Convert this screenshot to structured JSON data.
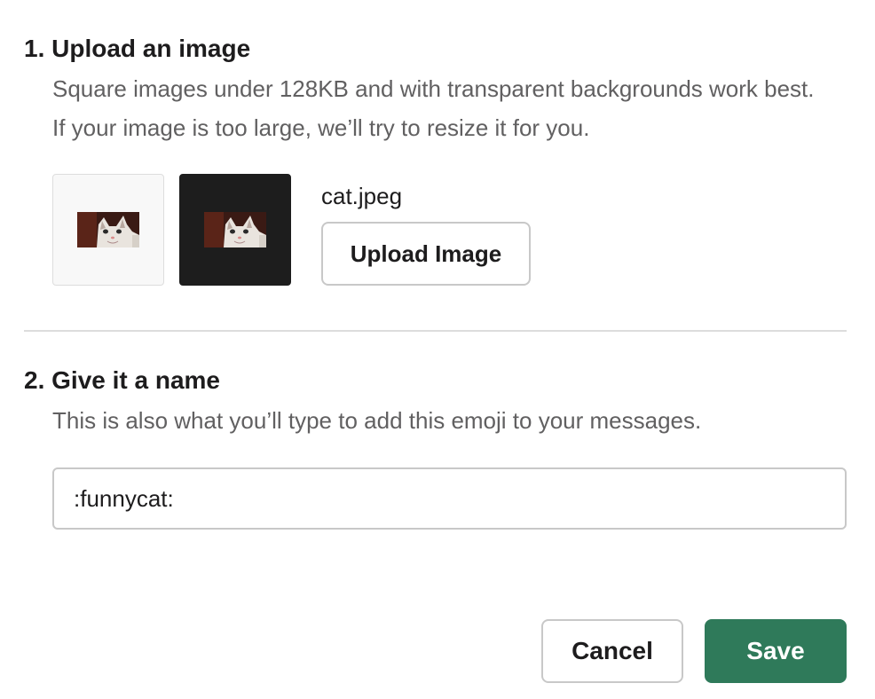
{
  "step1": {
    "title": "1. Upload an image",
    "description": "Square images under 128KB and with transparent backgrounds work best. If your image is too large, we’ll try to resize it for you.",
    "file_name": "cat.jpeg",
    "upload_button_label": "Upload Image"
  },
  "step2": {
    "title": "2. Give it a name",
    "description": "This is also what you’ll type to add this emoji to your messages.",
    "name_value": ":funnycat:"
  },
  "actions": {
    "cancel_label": "Cancel",
    "save_label": "Save"
  },
  "colors": {
    "save_button": "#2f7a5a",
    "light_preview_bg": "#f8f8f8",
    "dark_preview_bg": "#1d1d1d"
  }
}
